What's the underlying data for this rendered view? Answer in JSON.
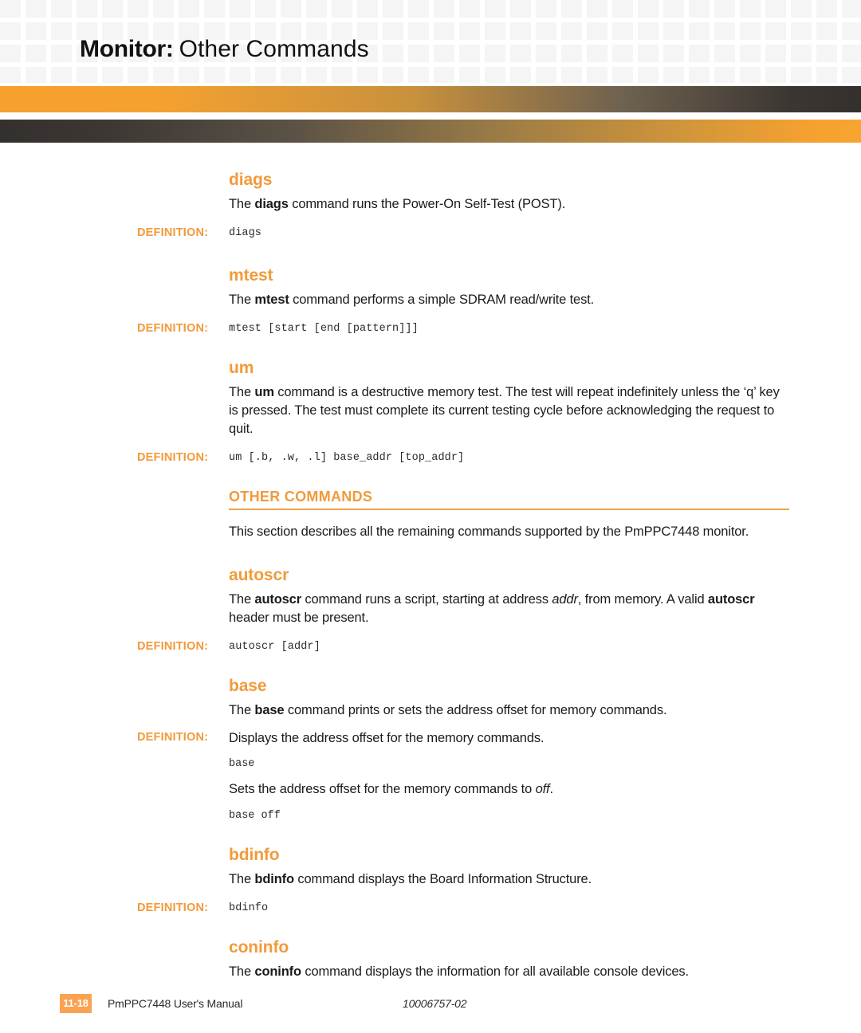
{
  "header": {
    "title_strong": "Monitor:",
    "title_light": "Other Commands",
    "accent_color": "#f29a3a",
    "bar_dark_color": "#34302d"
  },
  "labels": {
    "definition": "DEFINITION:"
  },
  "sections": [
    {
      "id": "diags",
      "heading": "diags",
      "body_prefix": "The ",
      "body_bold": "diags",
      "body_suffix": " command runs the Power-On Self-Test (POST).",
      "definition": "diags"
    },
    {
      "id": "mtest",
      "heading": "mtest",
      "body_prefix": "The ",
      "body_bold": "mtest",
      "body_suffix": " command performs a simple SDRAM read/write test.",
      "definition": "mtest [start [end [pattern]]]"
    },
    {
      "id": "um",
      "heading": "um",
      "body_prefix": "The ",
      "body_bold": "um",
      "body_suffix": " command is a destructive memory test. The test will repeat indefinitely unless the ‘q’ key is pressed. The test must complete its current testing cycle before acknowledging the request to quit.",
      "definition": "um [.b, .w, .l] base_addr [top_addr]"
    }
  ],
  "other_commands": {
    "heading": "OTHER COMMANDS",
    "intro": "This section describes all the remaining commands supported by the PmPPC7448 monitor.",
    "sections": [
      {
        "id": "autoscr",
        "heading": "autoscr",
        "body_part1": "The ",
        "body_bold1": "autoscr",
        "body_part2": " command runs a script, starting at address ",
        "body_italic": "addr",
        "body_part3": ", from memory. A valid ",
        "body_bold2": "autoscr",
        "body_part4": " header must be present.",
        "definition": "autoscr [addr]"
      },
      {
        "id": "base",
        "heading": "base",
        "body_prefix": "The ",
        "body_bold": "base",
        "body_suffix": " command prints or sets the address offset for memory commands.",
        "definition_prose": "Displays the address offset for the memory commands.",
        "code1": "base",
        "prose2_prefix": "Sets the address offset for the memory commands to ",
        "prose2_italic": "off",
        "prose2_suffix": ".",
        "code2": "base off"
      },
      {
        "id": "bdinfo",
        "heading": "bdinfo",
        "body_prefix": "The ",
        "body_bold": "bdinfo",
        "body_suffix": " command displays the Board Information Structure.",
        "definition": "bdinfo"
      },
      {
        "id": "coninfo",
        "heading": "coninfo",
        "body_prefix": "The ",
        "body_bold": "coninfo",
        "body_suffix": " command displays the information for all available console devices."
      }
    ]
  },
  "footer": {
    "page_number": "11-18",
    "manual_title": "PmPPC7448 User's Manual",
    "document_number": "10006757-02",
    "badge_color": "#f9a252"
  }
}
